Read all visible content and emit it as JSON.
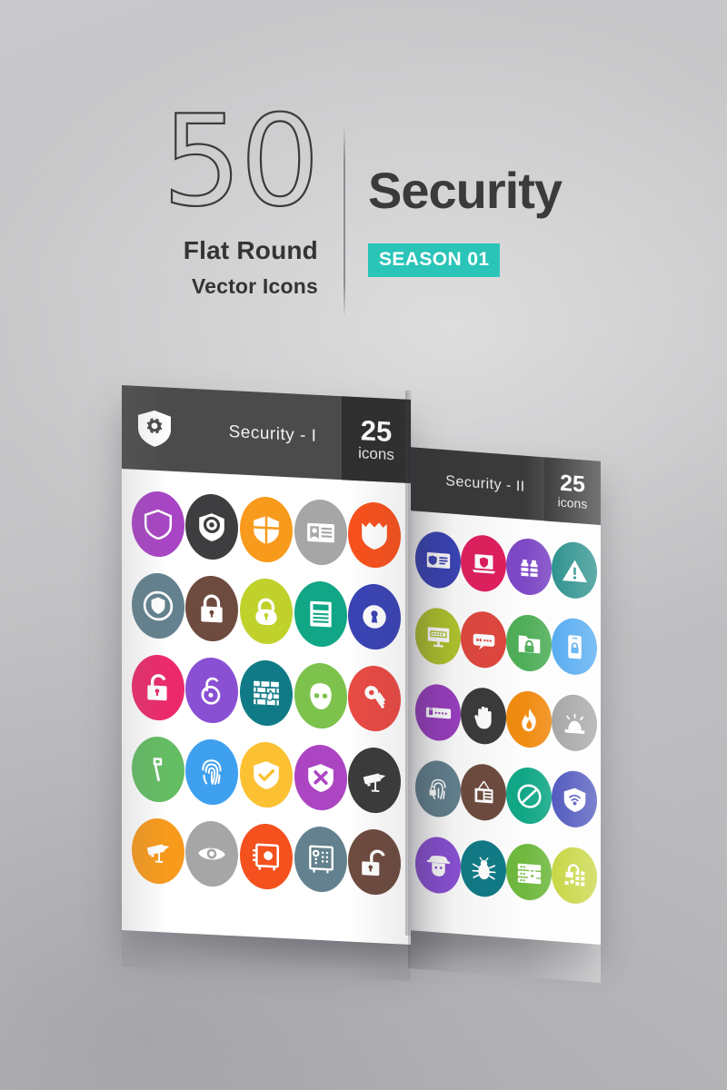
{
  "background": {
    "base_color": "#c6c6c8"
  },
  "header": {
    "count": "50",
    "subtitle_line1": "Flat Round",
    "subtitle_line2": "Vector Icons",
    "title": "Security",
    "season_badge": "SEASON 01",
    "season_badge_color": "#2ac4b8",
    "text_color": "#3b3b3b"
  },
  "cards": [
    {
      "id": "security-1",
      "bar_title": "Security - I",
      "badge_number": "25",
      "badge_label": "icons",
      "bar_color": "#4b4b4b",
      "badge_color": "#2f2f2f",
      "brand_icon": "shield-gear-icon",
      "icons": [
        {
          "name": "shield-icon",
          "color": "#a845c4"
        },
        {
          "name": "shield-gear-icon",
          "color": "#3e3e40"
        },
        {
          "name": "shield-quarters-icon",
          "color": "#f89a1c"
        },
        {
          "name": "id-card-icon",
          "color": "#a6a6a6"
        },
        {
          "name": "shield-crown-icon",
          "color": "#f9511d"
        },
        {
          "name": "shield-outline-icon",
          "color": "#63818e"
        },
        {
          "name": "padlock-closed-icon",
          "color": "#6e4b3f"
        },
        {
          "name": "padlock-rounded-icon",
          "color": "#c0d12c"
        },
        {
          "name": "document-lines-icon",
          "color": "#11a786"
        },
        {
          "name": "keyhole-icon",
          "color": "#3a43b5"
        },
        {
          "name": "padlock-open-icon",
          "color": "#ec2a6b"
        },
        {
          "name": "padlock-circle-icon",
          "color": "#8a50d4"
        },
        {
          "name": "firewall-icon",
          "color": "#107b86"
        },
        {
          "name": "mask-icon",
          "color": "#7ec24e"
        },
        {
          "name": "key-icon",
          "color": "#ea4a44"
        },
        {
          "name": "key-flat-icon",
          "color": "#63bd63"
        },
        {
          "name": "fingerprint-icon",
          "color": "#3fa0ef"
        },
        {
          "name": "shield-check-icon",
          "color": "#fbc132"
        },
        {
          "name": "shield-cross-icon",
          "color": "#ab45c2"
        },
        {
          "name": "cctv-camera-icon",
          "color": "#3b3b3b"
        },
        {
          "name": "cctv-camera-orange-icon",
          "color": "#f89a1c"
        },
        {
          "name": "eye-icon",
          "color": "#a6a6a6"
        },
        {
          "name": "safe-box-icon",
          "color": "#f4511e"
        },
        {
          "name": "safe-keypad-icon",
          "color": "#63818e"
        },
        {
          "name": "padlock-unlocked-icon",
          "color": "#6e4b3f"
        }
      ]
    },
    {
      "id": "security-2",
      "bar_title": "Security - II",
      "badge_number": "25",
      "badge_label": "icons",
      "bar_color": "#3a3a3a",
      "badge_color": "#2a2a2a",
      "icons": [
        {
          "name": "id-badge-icon",
          "color": "#3a43b5"
        },
        {
          "name": "laptop-shield-icon",
          "color": "#e01f5e"
        },
        {
          "name": "chained-bottles-icon",
          "color": "#7e48c6"
        },
        {
          "name": "warning-triangle-icon",
          "color": "#11837e"
        },
        {
          "name": "monitor-password-icon",
          "color": "#b1c32c"
        },
        {
          "name": "password-field-icon",
          "color": "#e0473f"
        },
        {
          "name": "folder-lock-icon",
          "color": "#4fae58"
        },
        {
          "name": "phone-lock-icon",
          "color": "#3fa0ef"
        },
        {
          "name": "password-bar-icon",
          "color": "#9a3ec0"
        },
        {
          "name": "stop-hand-icon",
          "color": "#3b3b3b"
        },
        {
          "name": "flame-icon",
          "color": "#f18b11"
        },
        {
          "name": "siren-alarm-icon",
          "color": "#9a9a9a"
        },
        {
          "name": "fingerprint-lock-icon",
          "color": "#63818e"
        },
        {
          "name": "id-lanyard-icon",
          "color": "#6e4b3f"
        },
        {
          "name": "prohibition-icon",
          "color": "#11a786"
        },
        {
          "name": "shield-wifi-icon",
          "color": "#3a43b5"
        },
        {
          "name": "spy-hacker-icon",
          "color": "#8a50d4"
        },
        {
          "name": "bug-icon",
          "color": "#107b86"
        },
        {
          "name": "server-lock-icon",
          "color": "#6fb93f"
        },
        {
          "name": "keypad-lock-icon",
          "color": "#c0d12c"
        }
      ]
    }
  ]
}
